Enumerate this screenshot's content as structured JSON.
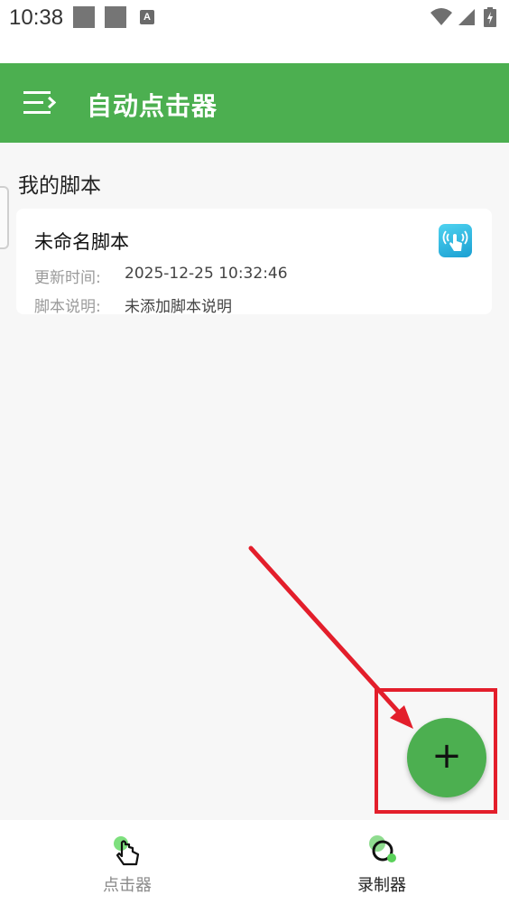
{
  "status_bar": {
    "time": "10:38",
    "notification_icons": [
      "square-notification-icon",
      "square-notification-icon",
      "a-notification-icon"
    ],
    "notif_letter": "A",
    "system_icons": [
      "wifi-icon",
      "signal-icon",
      "battery-charging-icon"
    ]
  },
  "app_bar": {
    "title": "自动点击器",
    "color": "#4caf50"
  },
  "section": {
    "title": "我的脚本"
  },
  "scripts": [
    {
      "name": "未命名脚本",
      "updated_label": "更新时间:",
      "updated_value": "2025-12-25 10:32:46",
      "desc_label": "脚本说明:",
      "desc_value": "未添加脚本说明",
      "icon": "touch-app-icon"
    }
  ],
  "fab": {
    "label": "+"
  },
  "bottom_nav": {
    "items": [
      {
        "label": "点击器",
        "icon": "tap-hand-icon",
        "selected": false
      },
      {
        "label": "录制器",
        "icon": "record-icon",
        "selected": true
      }
    ]
  },
  "colors": {
    "accent": "#4caf50",
    "annotation": "#e31e2b",
    "background": "#f7f7f7"
  }
}
